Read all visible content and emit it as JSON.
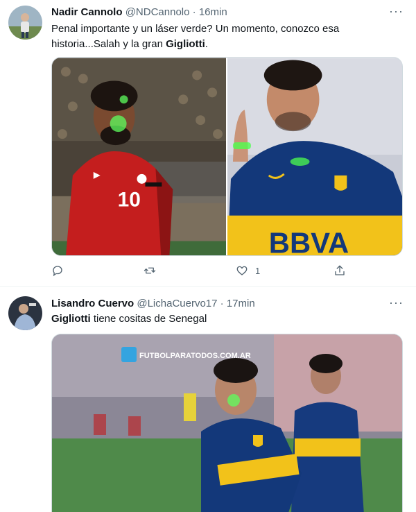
{
  "tweets": [
    {
      "display_name": "Nadir Cannolo",
      "handle": "@NDCannolo",
      "separator": "·",
      "time": "16min",
      "text_parts": [
        "Penal importante y un láser verde? Un momento, conozco esa historia...Salah y la gran ",
        "Gigliotti",
        "."
      ],
      "more": "···",
      "media_left": {
        "shirt_number": "10"
      },
      "media_right": {
        "sponsor": "BBVA"
      },
      "actions": {
        "reply_count": "",
        "retweet_count": "",
        "like_count": "1",
        "share_count": ""
      }
    },
    {
      "display_name": "Lisandro Cuervo",
      "handle": "@LichaCuervo17",
      "separator": "·",
      "time": "17min",
      "text_parts": [
        "Gigliotti",
        " tiene cositas de Senegal"
      ],
      "more": "···",
      "media": {
        "watermark": "FUTBOLPARATODOS.COM.AR"
      }
    }
  ],
  "colors": {
    "text": "#0f1419",
    "muted": "#536471",
    "border": "#cfd9de",
    "divider": "#eff3f4"
  },
  "icons": [
    "reply-icon",
    "retweet-icon",
    "like-icon",
    "share-icon",
    "more-icon"
  ]
}
